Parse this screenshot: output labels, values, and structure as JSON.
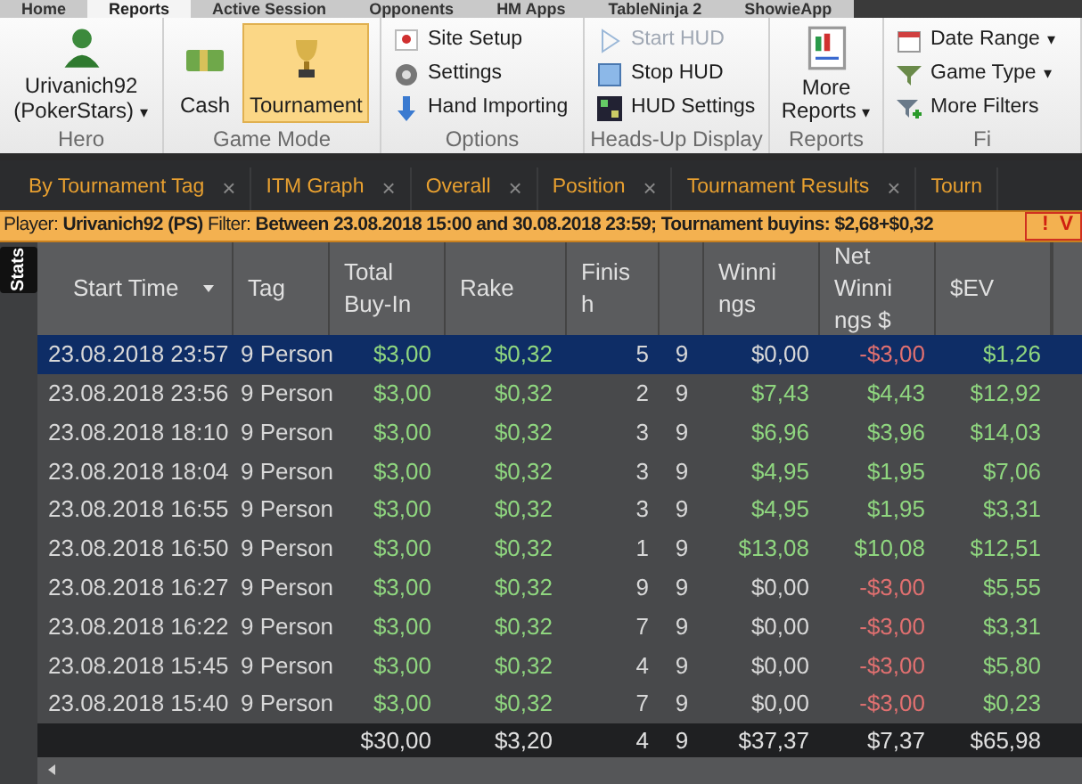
{
  "ribbon_tabs": [
    {
      "label": "Home",
      "selected": false
    },
    {
      "label": "Reports",
      "selected": true
    },
    {
      "label": "Active Session",
      "selected": false
    },
    {
      "label": "Opponents",
      "selected": false
    },
    {
      "label": "HM Apps",
      "selected": false
    },
    {
      "label": "TableNinja 2",
      "selected": false
    },
    {
      "label": "ShowieApp",
      "selected": false
    }
  ],
  "ribbon": {
    "hero": {
      "name": "Urivanich92",
      "site": "(PokerStars)",
      "caret": "▾",
      "group": "Hero"
    },
    "game_mode": {
      "buttons": [
        {
          "label": "Cash",
          "selected": false
        },
        {
          "label": "Tournament",
          "selected": true
        }
      ],
      "group": "Game Mode"
    },
    "options": {
      "items": [
        {
          "label": "Site Setup"
        },
        {
          "label": "Settings"
        },
        {
          "label": "Hand Importing"
        }
      ],
      "group": "Options"
    },
    "hud": {
      "items": [
        {
          "label": "Start HUD",
          "disabled": true
        },
        {
          "label": "Stop HUD",
          "disabled": false
        },
        {
          "label": "HUD Settings",
          "disabled": false
        }
      ],
      "group": "Heads-Up Display"
    },
    "reports": {
      "label": "More",
      "label2": "Reports",
      "caret": "▾",
      "group": "Reports"
    },
    "filters": {
      "items": [
        {
          "label": "Date Range",
          "caret": "▾"
        },
        {
          "label": "Game Type",
          "caret": "▾"
        },
        {
          "label": "More Filters"
        }
      ],
      "group": "Fi"
    }
  },
  "doc_tabs": [
    {
      "label": "By Tournament Tag",
      "close": "×"
    },
    {
      "label": "ITM Graph",
      "close": "×"
    },
    {
      "label": "Overall",
      "close": "×"
    },
    {
      "label": "Position",
      "close": "×"
    },
    {
      "label": "Tournament Results",
      "close": "×"
    },
    {
      "label": "Tourn"
    }
  ],
  "filter_bar": {
    "player_label": "Player:",
    "player": "Urivanich92 (PS)",
    "filter_label": "Filter:",
    "filter": "Between 23.08.2018 15:00 and 30.08.2018 23:59; Tournament buyins: $2,68+$0,32",
    "alert": "!",
    "alert_text": "V"
  },
  "side_tab": "Stats",
  "table": {
    "columns": [
      {
        "label": "Start Time",
        "sorted": true
      },
      {
        "label": "Tag",
        "sorted": false
      },
      {
        "label": "Total\nBuy-In",
        "sorted": false
      },
      {
        "label": "Rake",
        "sorted": false
      },
      {
        "label": "Finis\nh",
        "sorted": false
      },
      {
        "sorted": false
      },
      {
        "label": "Winni\nngs",
        "sorted": false
      },
      {
        "label": "Net\nWinni\nngs $",
        "sorted": false
      },
      {
        "label": "$EV",
        "sorted": false
      }
    ],
    "rows": [
      {
        "selected": true,
        "cells": [
          "23.08.2018 23:57",
          "9 Person",
          "$3,00",
          "$0,32",
          "5",
          "9",
          "$0,00",
          "-$3,00",
          "$1,26"
        ]
      },
      {
        "selected": false,
        "cells": [
          "23.08.2018 23:56",
          "9 Person",
          "$3,00",
          "$0,32",
          "2",
          "9",
          "$7,43",
          "$4,43",
          "$12,92"
        ]
      },
      {
        "selected": false,
        "cells": [
          "23.08.2018 18:10",
          "9 Person",
          "$3,00",
          "$0,32",
          "3",
          "9",
          "$6,96",
          "$3,96",
          "$14,03"
        ]
      },
      {
        "selected": false,
        "cells": [
          "23.08.2018 18:04",
          "9 Person",
          "$3,00",
          "$0,32",
          "3",
          "9",
          "$4,95",
          "$1,95",
          "$7,06"
        ]
      },
      {
        "selected": false,
        "cells": [
          "23.08.2018 16:55",
          "9 Person",
          "$3,00",
          "$0,32",
          "3",
          "9",
          "$4,95",
          "$1,95",
          "$3,31"
        ]
      },
      {
        "selected": false,
        "cells": [
          "23.08.2018 16:50",
          "9 Person",
          "$3,00",
          "$0,32",
          "1",
          "9",
          "$13,08",
          "$10,08",
          "$12,51"
        ]
      },
      {
        "selected": false,
        "cells": [
          "23.08.2018 16:27",
          "9 Person",
          "$3,00",
          "$0,32",
          "9",
          "9",
          "$0,00",
          "-$3,00",
          "$5,55"
        ]
      },
      {
        "selected": false,
        "cells": [
          "23.08.2018 16:22",
          "9 Person",
          "$3,00",
          "$0,32",
          "7",
          "9",
          "$0,00",
          "-$3,00",
          "$3,31"
        ]
      },
      {
        "selected": false,
        "cells": [
          "23.08.2018 15:45",
          "9 Person",
          "$3,00",
          "$0,32",
          "4",
          "9",
          "$0,00",
          "-$3,00",
          "$5,80"
        ]
      },
      {
        "selected": false,
        "cells": [
          "23.08.2018 15:40",
          "9 Person",
          "$3,00",
          "$0,32",
          "7",
          "9",
          "$0,00",
          "-$3,00",
          "$0,23"
        ]
      }
    ],
    "totals": [
      "$30,00",
      "$3,20",
      "4",
      "9",
      "$37,37",
      "$7,37",
      "$65,98"
    ]
  }
}
